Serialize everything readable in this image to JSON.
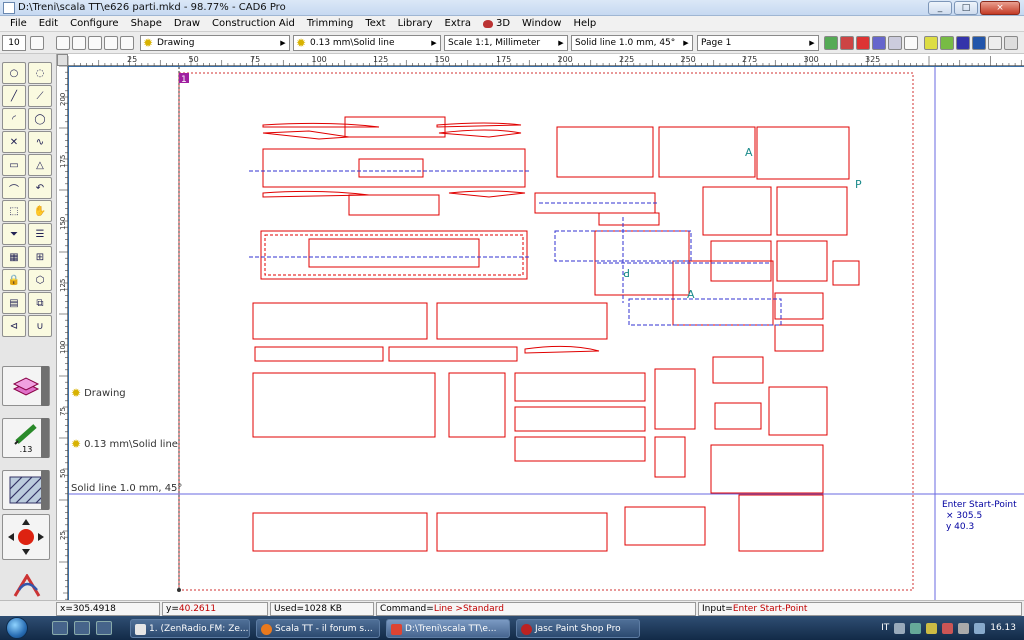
{
  "window": {
    "title": "D:\\Treni\\scala TT\\e626 parti.mkd - 98.77% - CAD6 Pro",
    "buttons": [
      "_",
      "□",
      "×"
    ]
  },
  "menu": [
    "File",
    "Edit",
    "Configure",
    "Shape",
    "Draw",
    "Construction Aid",
    "Trimming",
    "Text",
    "Library",
    "Extra",
    "3D",
    "Window",
    "Help"
  ],
  "toolbar": {
    "zoom_value": "10",
    "layer": "Drawing",
    "pen": "0.13 mm\\Solid line",
    "scale": "Scale 1:1, Millimeter",
    "hatch": "Solid line 1.0 mm, 45°",
    "page": "Page 1"
  },
  "ruler": {
    "h_labels": [
      "25",
      "50",
      "75",
      "100",
      "125",
      "150",
      "175",
      "200",
      "225",
      "250",
      "275",
      "300",
      "325"
    ],
    "v_labels": [
      "200",
      "175",
      "150",
      "125",
      "100",
      "75",
      "50",
      "25"
    ]
  },
  "leftbar": {
    "pen_size": ".13"
  },
  "canvas": {
    "page_number": "1",
    "float_layer": "Drawing",
    "float_pen": "0.13 mm\\Solid line",
    "float_hatch": "Solid line 1.0 mm, 45°",
    "part_labels": [
      "A",
      "P",
      "A",
      "P"
    ]
  },
  "info_panel": {
    "prompt": "Enter Start-Point",
    "x_line": "× 305.5",
    "y_line": "y  40.3"
  },
  "status": {
    "x_label": "x=",
    "x_value": "305.4918",
    "y_label": "y=",
    "y_value": "40.2611",
    "used": "Used=1028 KB",
    "command_label": "Command=",
    "command_value": "Line >Standard",
    "input_label": "Input=",
    "input_value": "Enter Start-Point"
  },
  "taskbar": {
    "tasks": [
      "1. (ZenRadio.FM: Ze...",
      "Scala TT - il forum s...",
      "D:\\Treni\\scala TT\\e...",
      "Jasc Paint Shop Pro"
    ],
    "lang": "IT",
    "clock": "16.13"
  },
  "colors": {
    "drawing": "#e00000",
    "guides": "#3030d0",
    "accent": "#3a6ea5"
  }
}
